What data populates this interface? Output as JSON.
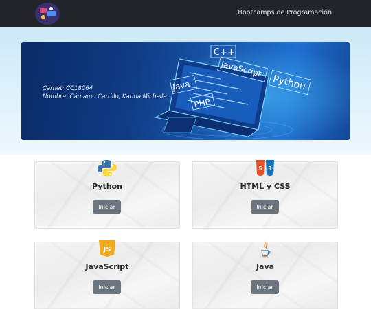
{
  "navbar": {
    "brand_icon": "bootcamp-logo-icon",
    "link_label": "Bootcamps de Programación"
  },
  "banner": {
    "line1": "Carnet: CC18064",
    "line2": "Nombre: Cárcamo Carrillo, Karina Michelle",
    "illustration_labels": [
      "C++",
      "JavaScript",
      "Python",
      "Java",
      "PHP"
    ]
  },
  "courses": [
    {
      "title": "Python",
      "button": "Iniciar",
      "icon": "python-icon"
    },
    {
      "title": "HTML y CSS",
      "button": "Iniciar",
      "icon": "html-css-icon"
    },
    {
      "title": "JavaScript",
      "button": "Iniciar",
      "icon": "javascript-icon"
    },
    {
      "title": "Java",
      "button": "Iniciar",
      "icon": "java-icon"
    }
  ],
  "colors": {
    "navbar": "#212529",
    "button": "#6c757d",
    "banner": "#103c85"
  }
}
